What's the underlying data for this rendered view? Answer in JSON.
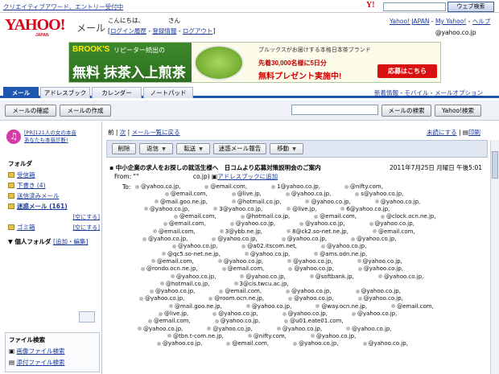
{
  "topbar": {
    "promo_text": "クリエイティブアワード、エントリー受付中",
    "logo_small": "Y!",
    "search_button": "ウェブ検索"
  },
  "header": {
    "logo": "YAHOO!",
    "logo_sub": "JAPAN",
    "mail_word": "メール",
    "greeting": "こんにちは、",
    "greeting_suffix": "さん",
    "login_history": "ログイン履歴",
    "registration": "登録情報",
    "logout": "ログアウト",
    "link_home": "Yahoo! JAPAN",
    "link_my": "My Yahoo!",
    "link_help": "ヘルプ",
    "account": "@yahoo.co.jp"
  },
  "banner": {
    "brand": "BROOK'S",
    "line1": "リピーター続出の",
    "headline": "無料 抹茶入上煎茶",
    "right_line1": "ブルックスがお届けする本格日本茶ブランド",
    "right_line2": "先着30,000名様に5日分",
    "right_line3": "無料プレゼント実施中!",
    "cta": "応募はこちら"
  },
  "tabs": [
    "メール",
    "アドレスブック",
    "カレンダー",
    "ノートパッド"
  ],
  "options": {
    "news": "新着情報",
    "mobile": "モバイル",
    "mail_option": "メールオプション"
  },
  "toolbar": {
    "check": "メールの確認",
    "compose": "メールの作成",
    "mail_search": "メールの検索",
    "yahoo_search": "Yahoo!検索"
  },
  "sidebar": {
    "promo": "[PR]121人の女の本音",
    "promo2": "あなたも本音診断!",
    "folder_header": "フォルダ",
    "folders": [
      {
        "name": "受信箱",
        "action": ""
      },
      {
        "name": "下書き (4)",
        "action": ""
      },
      {
        "name": "送信済みメール",
        "action": ""
      },
      {
        "name": "迷惑メール (161)",
        "action": "[空にする]"
      },
      {
        "name": "ゴミ箱",
        "action": "[空にする]"
      }
    ],
    "personal_folder": "個人フォルダ",
    "personal_action": "[追加・編集]",
    "file_search": "ファイル検索",
    "image_search": "画像ファイル検索",
    "attach_search": "添付ファイル検索"
  },
  "main": {
    "prev": "前",
    "next": "次",
    "back": "メール一覧に戻る",
    "unread": "未読にする",
    "print": "印刷",
    "buttons": {
      "delete": "削除",
      "reply": "返信",
      "forward": "転送",
      "spam": "迷惑メール報告",
      "move": "移動"
    },
    "subject": "中小企業の求人をお探しの就活生様へ　日コムより応募対策説明会のご案内",
    "date": "2011年7月25日 月曜日 午後5:01",
    "from_label": "From:",
    "from_addr": "\"\"　　　　　　　　　co.jp)",
    "add_address": "アドレスブックに追加",
    "to_label": "To:",
    "recipients": [
      [
        "@yahoo.co.jp,",
        "@email.com,",
        "1@yahoo.co.jp,",
        "@nifty.com,"
      ],
      [
        "@email.com,",
        "@live.jp,",
        "@yahoo.co.jp,",
        "s@yahoo.co.jp,"
      ],
      [
        "@mail.goo.ne.jp,",
        "@hotmail.co.jp,",
        "@yahoo.co.jp,",
        "@yahoo.co.jp,"
      ],
      [
        "@yahoo.co.jp,",
        "3@yahoo.co.jp,",
        "@live.jp,",
        "6@yahoo.co.jp,"
      ],
      [
        "@email.com,",
        "@hotmail.co.jp,",
        "@email.com,",
        "@clock.ocn.ne.jp,"
      ],
      [
        "@email.com,",
        "@yahoo.co.jp,",
        "@yahoo.co.jp,",
        "@yahoo.co.jp,"
      ],
      [
        "@email.com,",
        "3@ybb.ne.jp,",
        "8@ck2.so-net.ne.jp,",
        "@email.com,"
      ],
      [
        "@yahoo.co.jp,",
        "@yahoo.co.jp,",
        "@yahoo.co.jp,",
        "@yahoo.co.jp,"
      ],
      [
        "@yahoo.co.jp,",
        "@a02.itscom.net,",
        "@yahoo.co.jp,"
      ],
      [
        "@qc5.so-net.ne.jp,",
        "@yahoo.co.jp,",
        "@ams.odn.ne.jp,"
      ],
      [
        "@email.com,",
        "@yahoo.co.jp,",
        "@yahoo.co.jp,",
        "@yahoo.co.jp,"
      ],
      [
        "@rondo.ocn.ne.jp,",
        "@email.com,",
        "@yahoo.co.jp,",
        "@yahoo.co.jp,"
      ],
      [
        "@yahoo.co.jp,",
        "@yahoo.co.jp,",
        "@softbank.jp,",
        "@yahoo.co.jp,"
      ],
      [
        "@hotmail.co.jp,",
        "3@cis.twcu.ac.jp,"
      ],
      [
        "@yahoo.co.jp,",
        "@email.com,",
        "@yahoo.co.jp,",
        "@yahoo.co.jp,"
      ],
      [
        "@yahoo.co.jp,",
        "@room.ocn.ne.jp,",
        "@yahoo.co.jp,",
        "@yahoo.co.jp,"
      ],
      [
        "@mail.goo.ne.jp,",
        "@yahoo.co.jp,",
        "@way.ocn.ne.jp,",
        "@email.com,"
      ],
      [
        "@live.jp,",
        "@yahoo.co.jp,",
        "@yahoo.co.jp,",
        "@yahoo.co.jp,"
      ],
      [
        "@email.com,",
        "@yahoo.co.jp,",
        "@u01.eate01.com,"
      ],
      [
        "@yahoo.co.jp,",
        "@yahoo.co.jp,",
        "@yahoo.co.jp,",
        "@yahoo.co.jp,"
      ],
      [
        "@tbn.t-com.ne.jp,",
        "@nifty.com,",
        "@yahoo.co.jp,"
      ],
      [
        "@yahoo.co.jp,",
        "@email.com,",
        "@yahoo.co.jp,",
        "@yahoo.co.jp,"
      ]
    ]
  },
  "colors": {
    "accent": "#1e56b0",
    "logo": "#e00018",
    "link": "#1a3a9a"
  }
}
